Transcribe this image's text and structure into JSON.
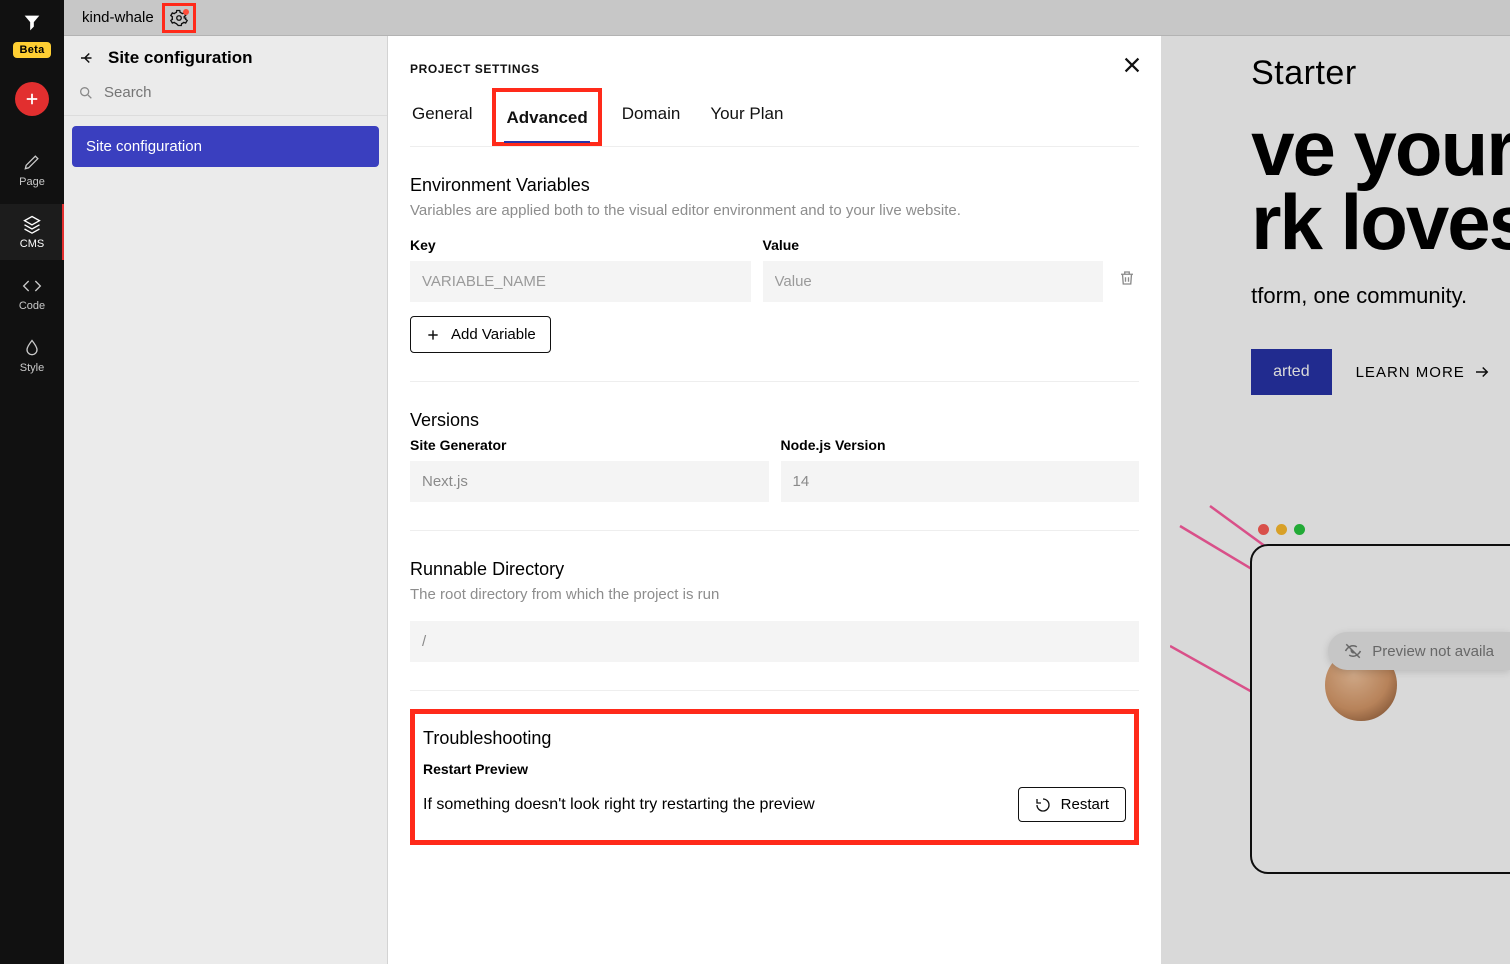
{
  "project_name": "kind-whale",
  "beta_badge": "Beta",
  "rail": {
    "page": "Page",
    "cms": "CMS",
    "code": "Code",
    "style": "Style"
  },
  "leftpanel": {
    "title": "Site configuration",
    "search_placeholder": "Search",
    "item_site_config": "Site configuration"
  },
  "modal": {
    "title": "PROJECT SETTINGS",
    "tabs": {
      "general": "General",
      "advanced": "Advanced",
      "domain": "Domain",
      "plan": "Your Plan"
    },
    "env": {
      "heading": "Environment Variables",
      "desc": "Variables are applied both to the visual editor environment and to your live website.",
      "key_label": "Key",
      "value_label": "Value",
      "key_placeholder": "VARIABLE_NAME",
      "value_placeholder": "Value",
      "add_btn": "Add Variable"
    },
    "versions": {
      "heading": "Versions",
      "site_gen_label": "Site Generator",
      "site_gen_value": "Next.js",
      "node_label": "Node.js Version",
      "node_value": "14"
    },
    "runnable": {
      "heading": "Runnable Directory",
      "desc": "The root directory from which the project is run",
      "value": "/"
    },
    "trouble": {
      "heading": "Troubleshooting",
      "sub": "Restart Preview",
      "desc": "If something doesn't look right try restarting the preview",
      "btn": "Restart"
    }
  },
  "preview": {
    "starter": "Starter",
    "hero1": "ve your",
    "hero2": "rk loves",
    "sub": "tform, one community.",
    "cta_primary": "arted",
    "cta_link": "LEARN MORE",
    "badge": "Preview not availa"
  }
}
